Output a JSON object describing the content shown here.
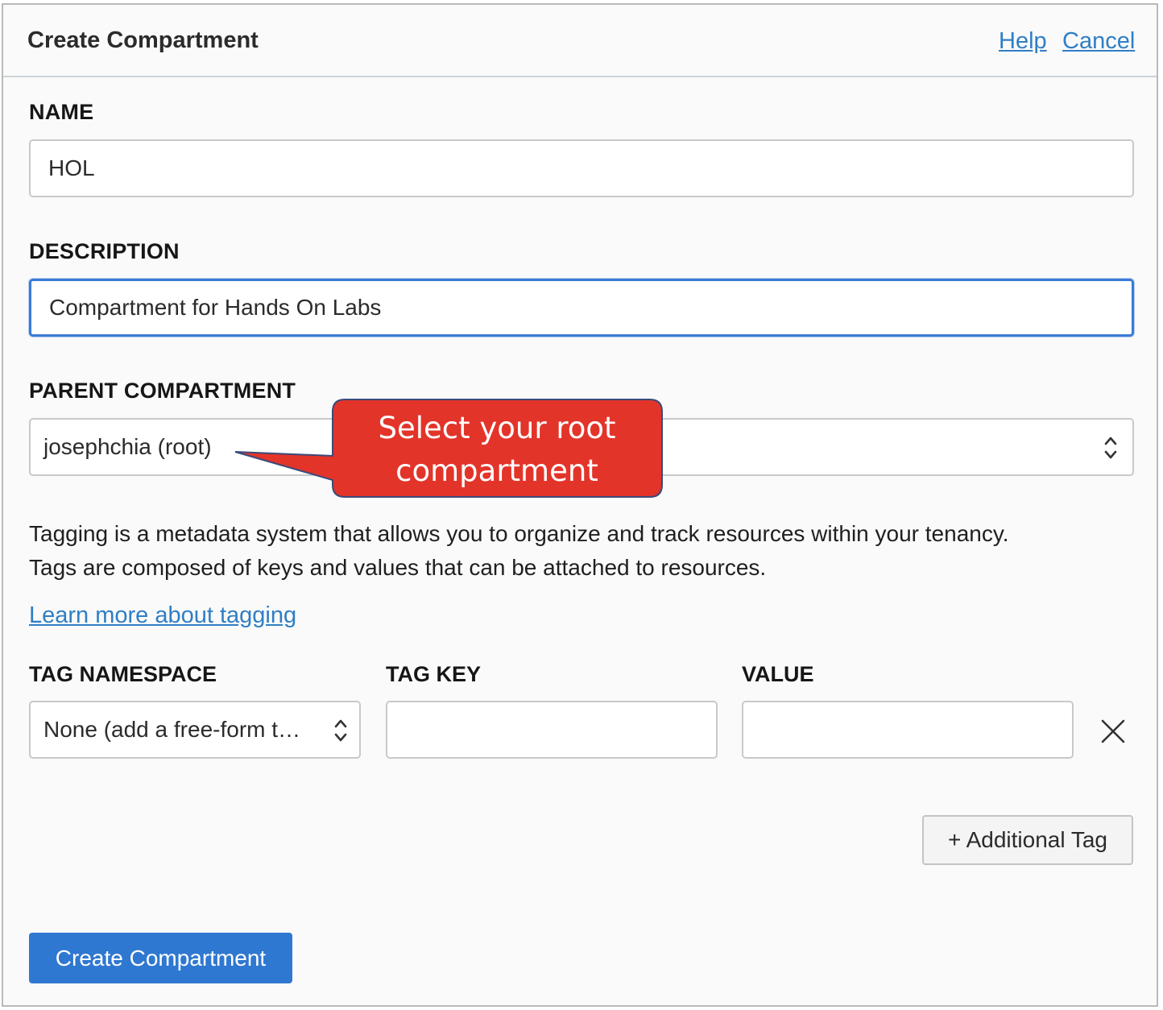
{
  "header": {
    "title": "Create Compartment",
    "help_label": "Help",
    "cancel_label": "Cancel"
  },
  "form": {
    "name": {
      "label": "NAME",
      "value": "HOL"
    },
    "description": {
      "label": "DESCRIPTION",
      "value": "Compartment for Hands On Labs"
    },
    "parent": {
      "label": "PARENT COMPARTMENT",
      "value": "josephchia (root)"
    },
    "tagging_text_line1": "Tagging is a metadata system that allows you to organize and track resources within your tenancy.",
    "tagging_text_line2": "Tags are composed of keys and values that can be attached to resources.",
    "learn_more_label": "Learn more about tagging",
    "tags": {
      "namespace_label": "TAG NAMESPACE",
      "key_label": "TAG KEY",
      "value_label": "VALUE",
      "namespace_value": "None (add a free-form t…",
      "key_value": "",
      "value_value": ""
    },
    "additional_tag_label": "+ Additional Tag",
    "submit_label": "Create Compartment"
  },
  "callout": {
    "line1": "Select your root",
    "line2": "compartment"
  },
  "colors": {
    "link": "#2f7ec4",
    "primary": "#2f78d1",
    "focus": "#3a7ad6",
    "callout": "#e3342a"
  },
  "icons": {
    "select_arrow": "chevron-up-down-icon",
    "remove": "close-icon"
  }
}
